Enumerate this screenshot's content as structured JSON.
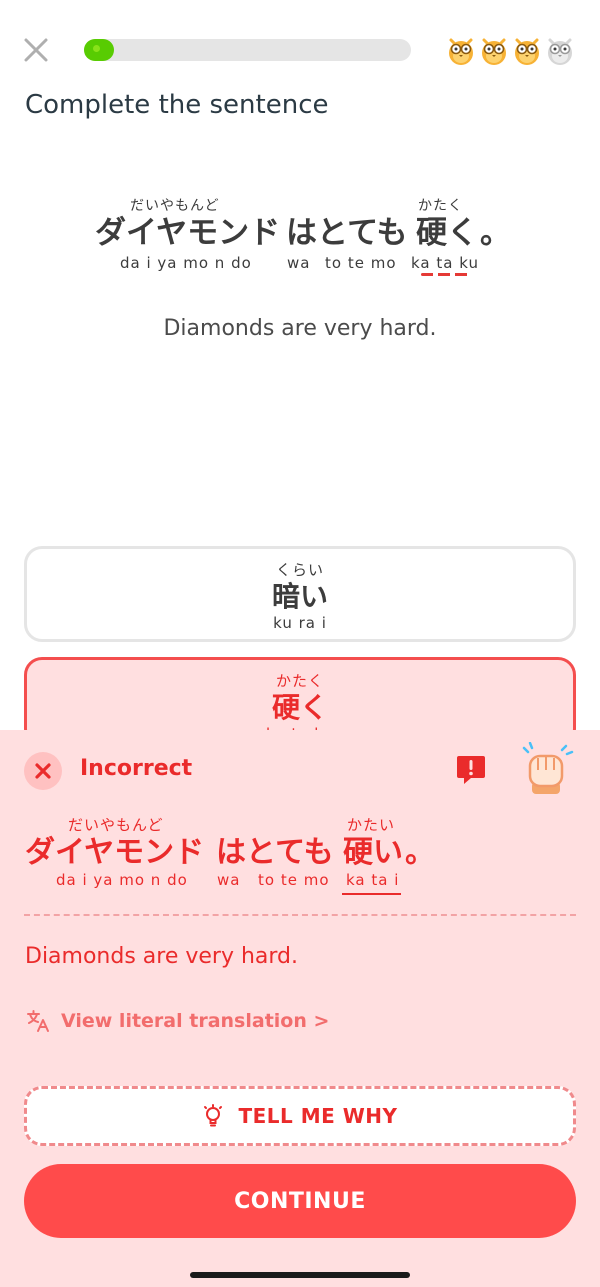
{
  "header": {
    "progress_percent": 8,
    "hearts": [
      {
        "icon": "owl-heart-icon",
        "active": true
      },
      {
        "icon": "owl-heart-icon",
        "active": true
      },
      {
        "icon": "owl-heart-icon",
        "active": true
      },
      {
        "icon": "owl-heart-icon",
        "active": false
      }
    ]
  },
  "title": "Complete the sentence",
  "prompt": {
    "furigana_1": "だいやもんど",
    "word_1": "ダイヤモンド",
    "romaji_1": "da i ya mo n do",
    "word_2": "はとても",
    "romaji_wa": "wa",
    "romaji_totemo": "to te mo",
    "furigana_3": "かたく",
    "word_3": "硬く",
    "romaji_3": "ka ta ku",
    "punct": "。"
  },
  "translation": "Diamonds are very hard.",
  "options": [
    {
      "furigana": "くらい",
      "word": "暗い",
      "romaji": "ku ra i"
    },
    {
      "furigana": "かたく",
      "word": "硬く",
      "romaji": "ka ta ku"
    }
  ],
  "feedback": {
    "status": "Incorrect",
    "answer": {
      "furigana_1": "だいやもんど",
      "word_1": "ダイヤモンド",
      "romaji_1": "da i ya mo n do",
      "word_2": "はとても",
      "romaji_wa": "wa",
      "romaji_totemo": "to te mo",
      "furigana_3": "かたい",
      "word_3": "硬い",
      "romaji_3": "ka ta i",
      "punct": "。"
    },
    "translation": "Diamonds are very hard.",
    "literal_link": "View literal translation >",
    "tell_me_why": "TELL ME WHY",
    "continue": "CONTINUE"
  },
  "colors": {
    "accent_red": "#ea2b2b",
    "panel_bg": "#ffdfe0",
    "progress_green": "#58cc02"
  }
}
